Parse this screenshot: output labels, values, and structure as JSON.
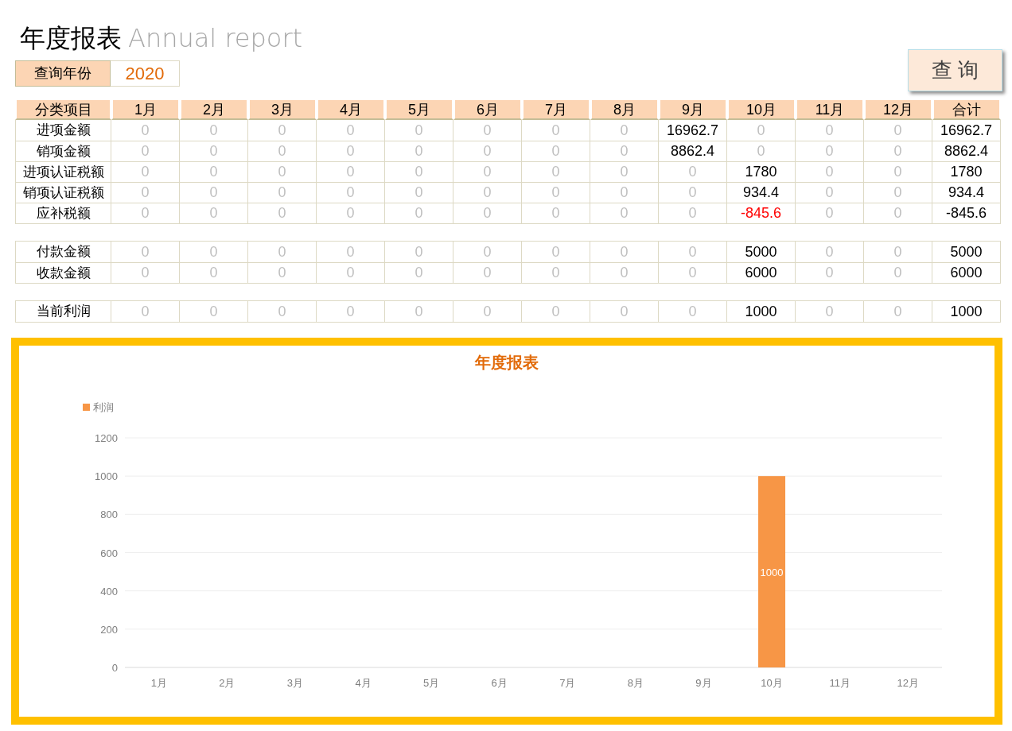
{
  "title": {
    "main": "年度报表",
    "sub": "Annual report"
  },
  "query": {
    "label": "查询年份",
    "year": "2020",
    "button": "查 询"
  },
  "table": {
    "columns": [
      "分类项目",
      "1月",
      "2月",
      "3月",
      "4月",
      "5月",
      "6月",
      "7月",
      "8月",
      "9月",
      "10月",
      "11月",
      "12月",
      "合计"
    ],
    "groups": [
      {
        "rows": [
          {
            "label": "进项金额",
            "cells": [
              {
                "text": "0",
                "color": "#bfbfbf"
              },
              {
                "text": "0",
                "color": "#bfbfbf"
              },
              {
                "text": "0",
                "color": "#bfbfbf"
              },
              {
                "text": "0",
                "color": "#bfbfbf"
              },
              {
                "text": "0",
                "color": "#bfbfbf"
              },
              {
                "text": "0",
                "color": "#bfbfbf"
              },
              {
                "text": "0",
                "color": "#bfbfbf"
              },
              {
                "text": "0",
                "color": "#bfbfbf"
              },
              {
                "text": "16962.7",
                "color": "#000000"
              },
              {
                "text": "0",
                "color": "#bfbfbf"
              },
              {
                "text": "0",
                "color": "#bfbfbf"
              },
              {
                "text": "0",
                "color": "#bfbfbf"
              },
              {
                "text": "16962.7",
                "color": "#000000"
              }
            ]
          },
          {
            "label": "销项金额",
            "cells": [
              {
                "text": "0",
                "color": "#bfbfbf"
              },
              {
                "text": "0",
                "color": "#bfbfbf"
              },
              {
                "text": "0",
                "color": "#bfbfbf"
              },
              {
                "text": "0",
                "color": "#bfbfbf"
              },
              {
                "text": "0",
                "color": "#bfbfbf"
              },
              {
                "text": "0",
                "color": "#bfbfbf"
              },
              {
                "text": "0",
                "color": "#bfbfbf"
              },
              {
                "text": "0",
                "color": "#bfbfbf"
              },
              {
                "text": "8862.4",
                "color": "#000000"
              },
              {
                "text": "0",
                "color": "#bfbfbf"
              },
              {
                "text": "0",
                "color": "#bfbfbf"
              },
              {
                "text": "0",
                "color": "#bfbfbf"
              },
              {
                "text": "8862.4",
                "color": "#000000"
              }
            ]
          },
          {
            "label": "进项认证税额",
            "cells": [
              {
                "text": "0",
                "color": "#bfbfbf"
              },
              {
                "text": "0",
                "color": "#bfbfbf"
              },
              {
                "text": "0",
                "color": "#bfbfbf"
              },
              {
                "text": "0",
                "color": "#bfbfbf"
              },
              {
                "text": "0",
                "color": "#bfbfbf"
              },
              {
                "text": "0",
                "color": "#bfbfbf"
              },
              {
                "text": "0",
                "color": "#bfbfbf"
              },
              {
                "text": "0",
                "color": "#bfbfbf"
              },
              {
                "text": "0",
                "color": "#bfbfbf"
              },
              {
                "text": "1780",
                "color": "#000000"
              },
              {
                "text": "0",
                "color": "#bfbfbf"
              },
              {
                "text": "0",
                "color": "#bfbfbf"
              },
              {
                "text": "1780",
                "color": "#000000"
              }
            ]
          },
          {
            "label": "销项认证税额",
            "cells": [
              {
                "text": "0",
                "color": "#bfbfbf"
              },
              {
                "text": "0",
                "color": "#bfbfbf"
              },
              {
                "text": "0",
                "color": "#bfbfbf"
              },
              {
                "text": "0",
                "color": "#bfbfbf"
              },
              {
                "text": "0",
                "color": "#bfbfbf"
              },
              {
                "text": "0",
                "color": "#bfbfbf"
              },
              {
                "text": "0",
                "color": "#bfbfbf"
              },
              {
                "text": "0",
                "color": "#bfbfbf"
              },
              {
                "text": "0",
                "color": "#bfbfbf"
              },
              {
                "text": "934.4",
                "color": "#000000"
              },
              {
                "text": "0",
                "color": "#bfbfbf"
              },
              {
                "text": "0",
                "color": "#bfbfbf"
              },
              {
                "text": "934.4",
                "color": "#000000"
              }
            ]
          },
          {
            "label": "应补税额",
            "cells": [
              {
                "text": "0",
                "color": "#bfbfbf"
              },
              {
                "text": "0",
                "color": "#bfbfbf"
              },
              {
                "text": "0",
                "color": "#bfbfbf"
              },
              {
                "text": "0",
                "color": "#bfbfbf"
              },
              {
                "text": "0",
                "color": "#bfbfbf"
              },
              {
                "text": "0",
                "color": "#bfbfbf"
              },
              {
                "text": "0",
                "color": "#bfbfbf"
              },
              {
                "text": "0",
                "color": "#bfbfbf"
              },
              {
                "text": "0",
                "color": "#bfbfbf"
              },
              {
                "text": "-845.6",
                "color": "#ff0000"
              },
              {
                "text": "0",
                "color": "#bfbfbf"
              },
              {
                "text": "0",
                "color": "#bfbfbf"
              },
              {
                "text": "-845.6",
                "color": "#000000"
              }
            ]
          }
        ]
      },
      {
        "rows": [
          {
            "label": "付款金额",
            "cells": [
              {
                "text": "0",
                "color": "#bfbfbf"
              },
              {
                "text": "0",
                "color": "#bfbfbf"
              },
              {
                "text": "0",
                "color": "#bfbfbf"
              },
              {
                "text": "0",
                "color": "#bfbfbf"
              },
              {
                "text": "0",
                "color": "#bfbfbf"
              },
              {
                "text": "0",
                "color": "#bfbfbf"
              },
              {
                "text": "0",
                "color": "#bfbfbf"
              },
              {
                "text": "0",
                "color": "#bfbfbf"
              },
              {
                "text": "0",
                "color": "#bfbfbf"
              },
              {
                "text": "5000",
                "color": "#000000"
              },
              {
                "text": "0",
                "color": "#bfbfbf"
              },
              {
                "text": "0",
                "color": "#bfbfbf"
              },
              {
                "text": "5000",
                "color": "#000000"
              }
            ]
          },
          {
            "label": "收款金额",
            "cells": [
              {
                "text": "0",
                "color": "#bfbfbf"
              },
              {
                "text": "0",
                "color": "#bfbfbf"
              },
              {
                "text": "0",
                "color": "#bfbfbf"
              },
              {
                "text": "0",
                "color": "#bfbfbf"
              },
              {
                "text": "0",
                "color": "#bfbfbf"
              },
              {
                "text": "0",
                "color": "#bfbfbf"
              },
              {
                "text": "0",
                "color": "#bfbfbf"
              },
              {
                "text": "0",
                "color": "#bfbfbf"
              },
              {
                "text": "0",
                "color": "#bfbfbf"
              },
              {
                "text": "6000",
                "color": "#000000"
              },
              {
                "text": "0",
                "color": "#bfbfbf"
              },
              {
                "text": "0",
                "color": "#bfbfbf"
              },
              {
                "text": "6000",
                "color": "#000000"
              }
            ]
          }
        ]
      },
      {
        "rows": [
          {
            "label": "当前利润",
            "cells": [
              {
                "text": "0",
                "color": "#bfbfbf"
              },
              {
                "text": "0",
                "color": "#bfbfbf"
              },
              {
                "text": "0",
                "color": "#bfbfbf"
              },
              {
                "text": "0",
                "color": "#bfbfbf"
              },
              {
                "text": "0",
                "color": "#bfbfbf"
              },
              {
                "text": "0",
                "color": "#bfbfbf"
              },
              {
                "text": "0",
                "color": "#bfbfbf"
              },
              {
                "text": "0",
                "color": "#bfbfbf"
              },
              {
                "text": "0",
                "color": "#bfbfbf"
              },
              {
                "text": "1000",
                "color": "#000000"
              },
              {
                "text": "0",
                "color": "#bfbfbf"
              },
              {
                "text": "0",
                "color": "#bfbfbf"
              },
              {
                "text": "1000",
                "color": "#000000"
              }
            ]
          }
        ]
      }
    ]
  },
  "chart": {
    "chart_data": {
      "type": "bar",
      "title": "年度报表",
      "categories": [
        "1月",
        "2月",
        "3月",
        "4月",
        "5月",
        "6月",
        "7月",
        "8月",
        "9月",
        "10月",
        "11月",
        "12月"
      ],
      "series": [
        {
          "name": "利润",
          "color": "#f79646",
          "values": [
            0,
            0,
            0,
            0,
            0,
            0,
            0,
            0,
            0,
            1000,
            0,
            0
          ]
        }
      ],
      "ylim": [
        0,
        1200
      ],
      "yticks": [
        0,
        200,
        400,
        600,
        800,
        1000,
        1200
      ],
      "grid": true,
      "value_labels": [
        null,
        null,
        null,
        null,
        null,
        null,
        null,
        null,
        null,
        "1000",
        null,
        null
      ]
    }
  }
}
